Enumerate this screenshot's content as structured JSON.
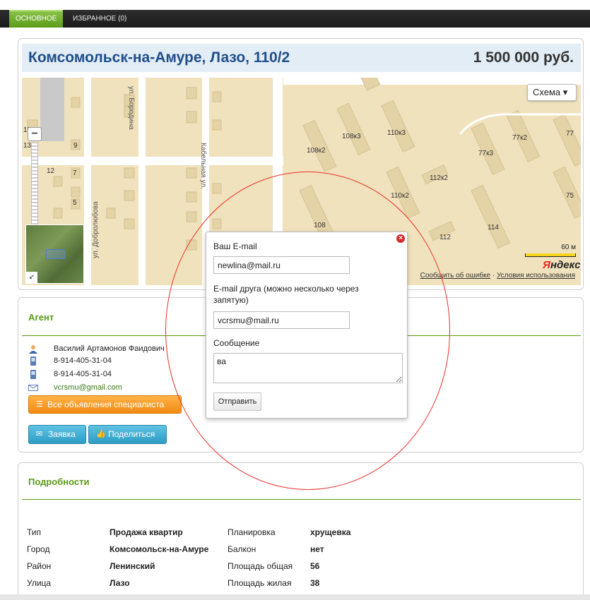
{
  "tabs": [
    {
      "label": "Основное",
      "active": true
    },
    {
      "label": "Избранное (0)",
      "active": false
    }
  ],
  "listing": {
    "title": "Комсомольск-на-Амуре, Лазо, 110/2",
    "price": "1 500 000 руб."
  },
  "map": {
    "mode_button": "Схема ▾",
    "scale_label": "60 м",
    "logo_y": "Я",
    "logo_rest": "ндекс",
    "report_link": "Сообщить об ошибке",
    "terms_link": "Условия использования",
    "street_labels": [
      "ул. Бородина",
      "Кабельная ул.",
      "ул. Добролюбова"
    ],
    "building_labels": [
      "108к2",
      "108к3",
      "110к3",
      "77к3",
      "77к2",
      "77",
      "112к2",
      "110к2",
      "75",
      "108",
      "114",
      "112",
      "12",
      "7",
      "9",
      "5",
      "15",
      "13"
    ]
  },
  "agent": {
    "heading": "Агент",
    "name": "Василий Артамонов Фаидович",
    "phone1": "8-914-405-31-04",
    "phone2": "8-914-405-31-04",
    "email": "vcrsmu@gmail.com",
    "all_listings_button": "Все объявления специалиста",
    "request_button": "Заявка",
    "share_button": "Поделиться"
  },
  "details": {
    "heading": "Подробности",
    "rows": [
      {
        "label": "Тип",
        "value": "Продажа квартир",
        "label2": "Планировка",
        "value2": "хрущевка"
      },
      {
        "label": "Город",
        "value": "Комсомольск-на-Амуре",
        "label2": "Балкон",
        "value2": "нет"
      },
      {
        "label": "Район",
        "value": "Ленинский",
        "label2": "Площадь общая",
        "value2": "56"
      },
      {
        "label": "Улица",
        "value": "Лазо",
        "label2": "Площадь жилая",
        "value2": "38"
      }
    ]
  },
  "share_popup": {
    "your_email_label": "Ваш E-mail",
    "your_email_value": "newlina@mail.ru",
    "friend_email_label_line1": "E-mail друга (можно несколько через",
    "friend_email_label_line2": "запятую)",
    "friend_email_value": "vcrsmu@mail.ru",
    "message_label": "Сообщение",
    "message_value": "ва",
    "send_button": "Отправить"
  },
  "colors": {
    "accent_green": "#5a9a16",
    "title_blue": "#1f4e8a",
    "annotation_red": "#e8322a",
    "button_orange": "#f08a12",
    "button_blue": "#2e9cc4"
  }
}
